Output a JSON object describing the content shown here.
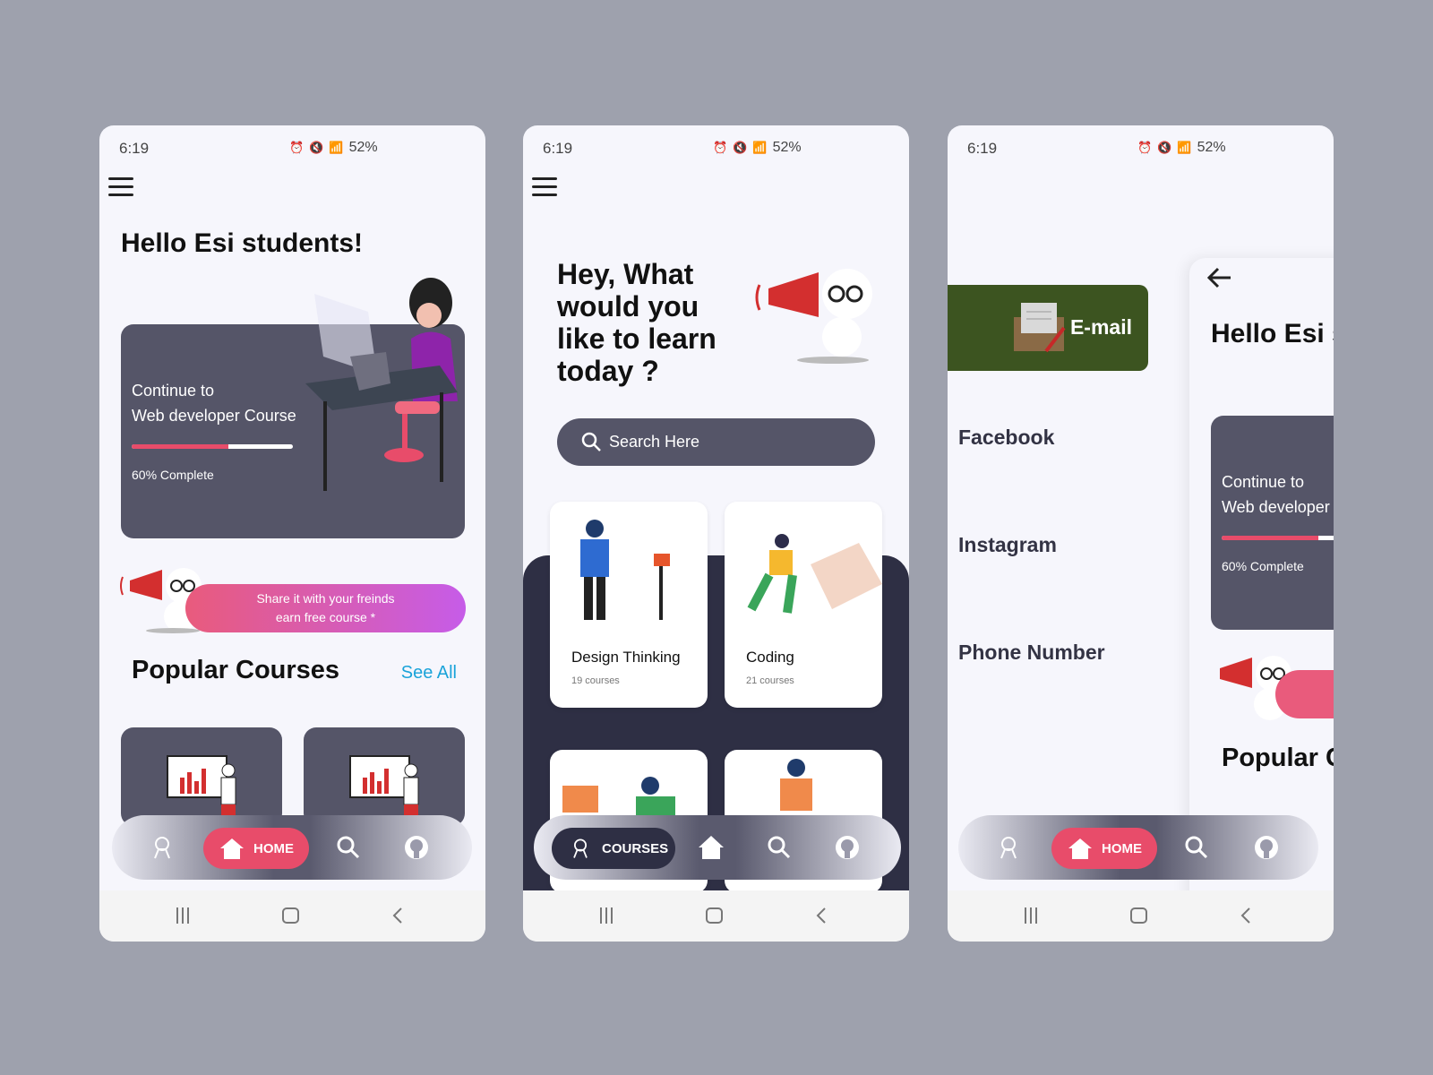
{
  "status": {
    "time": "6:19",
    "battery": "52%"
  },
  "screen1": {
    "greeting": "Hello Esi students!",
    "course_card": {
      "line1": "Continue to",
      "line2": "Web developer Course",
      "progress_label": "60% Complete",
      "progress": 0.6
    },
    "share": {
      "line1": "Share it with your freinds",
      "line2": "earn free course *"
    },
    "popular_title": "Popular Courses",
    "see_all": "See All",
    "nav_active": "HOME"
  },
  "screen2": {
    "hero": "Hey, What would you like to learn today ?",
    "search_placeholder": "Search Here",
    "categories": [
      {
        "name": "Design Thinking",
        "count": "19 courses"
      },
      {
        "name": "Coding",
        "count": "21 courses"
      }
    ],
    "nav_active": "COURSES"
  },
  "screen3": {
    "email": "E-mail",
    "links": [
      "Facebook",
      "Instagram",
      "Phone Number"
    ],
    "greeting_partial": "Hello Esi s",
    "course_card": {
      "line1": "Continue to",
      "line2": "Web developer",
      "progress_label": "60% Complete",
      "progress": 0.6
    },
    "popular_partial": "Popular C",
    "nav_active": "HOME"
  },
  "colors": {
    "accent": "#e84c6a",
    "dark": "#555568",
    "link": "#1aa3d9",
    "email_bg": "#3c5420"
  },
  "icons": [
    "menu-icon",
    "search-icon",
    "home-icon",
    "github-icon",
    "astronaut-icon",
    "back-arrow-icon"
  ]
}
